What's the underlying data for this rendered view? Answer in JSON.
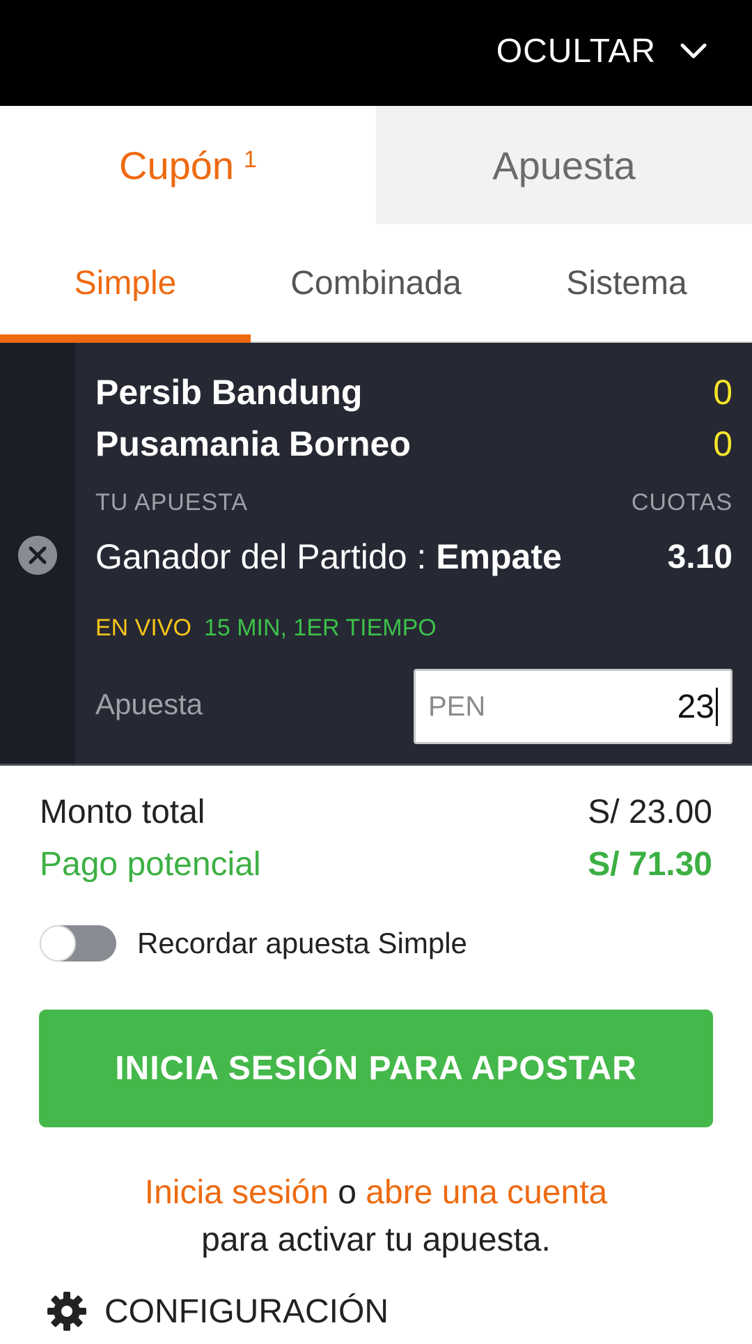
{
  "header": {
    "hide_label": "OCULTAR",
    "hide_icon": "chevron-down-icon"
  },
  "main_tabs": [
    {
      "label": "Cupón",
      "count": "1",
      "active": true
    },
    {
      "label": "Apuesta",
      "active": false
    }
  ],
  "sub_tabs": [
    {
      "label": "Simple",
      "active": true
    },
    {
      "label": "Combinada",
      "active": false
    },
    {
      "label": "Sistema",
      "active": false
    }
  ],
  "bet": {
    "team1": {
      "name": "Persib Bandung",
      "score": "0"
    },
    "team2": {
      "name": "Pusamania Borneo",
      "score": "0"
    },
    "your_bet_label": "TU APUESTA",
    "odds_label": "CUOTAS",
    "market": "Ganador del Partido :",
    "selection": "Empate",
    "odds": "3.10",
    "live_tag": "EN VIVO",
    "live_time": "15 MIN,  1ER TIEMPO",
    "stake_label": "Apuesta",
    "currency": "PEN",
    "stake_value": "23",
    "remove_icon": "close-icon"
  },
  "totals": {
    "total_label": "Monto total",
    "total_value": "S/ 23.00",
    "payout_label": "Pago potencial",
    "payout_value": "S/ 71.30"
  },
  "remember": {
    "label": "Recordar apuesta Simple",
    "enabled": false
  },
  "cta": {
    "label": "INICIA SESIÓN PARA APOSTAR"
  },
  "login_note": {
    "login_link": "Inicia sesión",
    "or": "o",
    "signup_link": "abre una cuenta",
    "suffix": "para activar tu apuesta."
  },
  "settings": {
    "label": "CONFIGURACIÓN",
    "icon": "gear-icon"
  },
  "colors": {
    "accent": "#ee6a10",
    "success": "#44b84a",
    "card_bg": "#262833",
    "score": "#f5e52a"
  }
}
